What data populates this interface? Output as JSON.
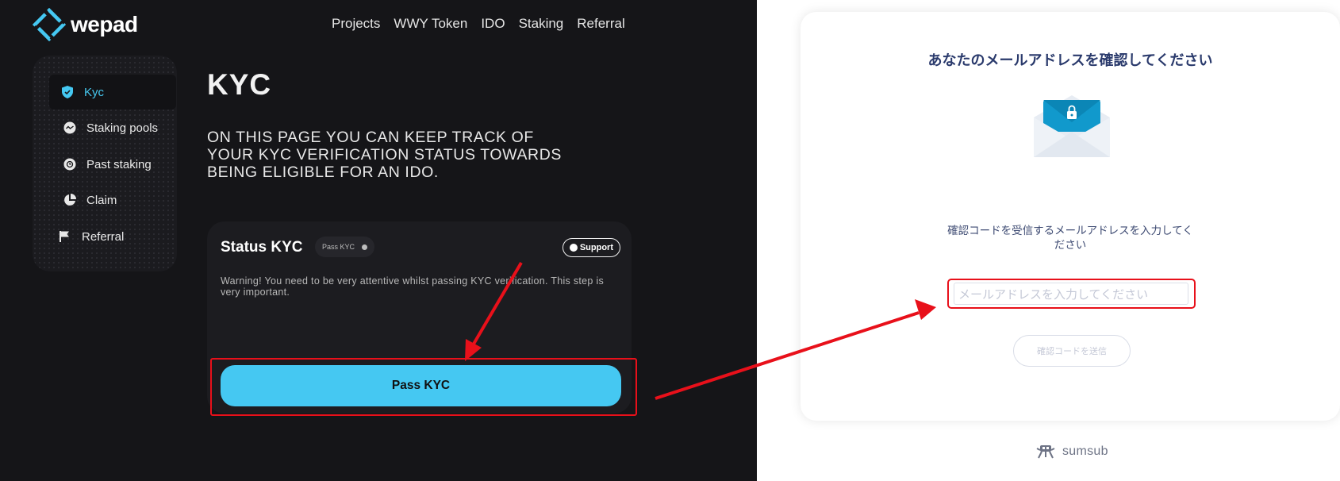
{
  "app": {
    "logo_text": "wepad",
    "brand_color": "#45c8f2"
  },
  "nav": {
    "items": [
      "Projects",
      "WWY Token",
      "IDO",
      "Staking",
      "Referral"
    ]
  },
  "sidebar": {
    "items": [
      {
        "label": "Kyc",
        "icon": "shield-icon",
        "active": true
      },
      {
        "label": "Staking pools",
        "icon": "staking-icon",
        "active": false
      },
      {
        "label": "Past staking",
        "icon": "clock-icon",
        "active": false
      },
      {
        "label": "Claim",
        "icon": "pie-chart-icon",
        "active": false
      },
      {
        "label": "Referral",
        "icon": "flag-icon",
        "active": false
      }
    ]
  },
  "main": {
    "title": "KYC",
    "description": "ON THIS PAGE YOU CAN KEEP TRACK OF YOUR KYC VERIFICATION STATUS TOWARDS BEING ELIGIBLE FOR AN IDO."
  },
  "status_card": {
    "title": "Status KYC",
    "badge": "Pass KYC",
    "support_label": "Support",
    "warning": "Warning! You need to be very attentive whilst passing KYC verification. This step is very important.",
    "button_label": "Pass KYC"
  },
  "verification": {
    "title": "あなたのメールアドレスを確認してください",
    "instruction": "確認コードを受信するメールアドレスを入力してください",
    "email_placeholder": "メールアドレスを入力してください",
    "send_button": "確認コードを送信",
    "provider": "sumsub"
  },
  "colors": {
    "accent": "#45c8f2",
    "highlight_red": "#e8101a",
    "title_navy": "#2a3a6c"
  }
}
